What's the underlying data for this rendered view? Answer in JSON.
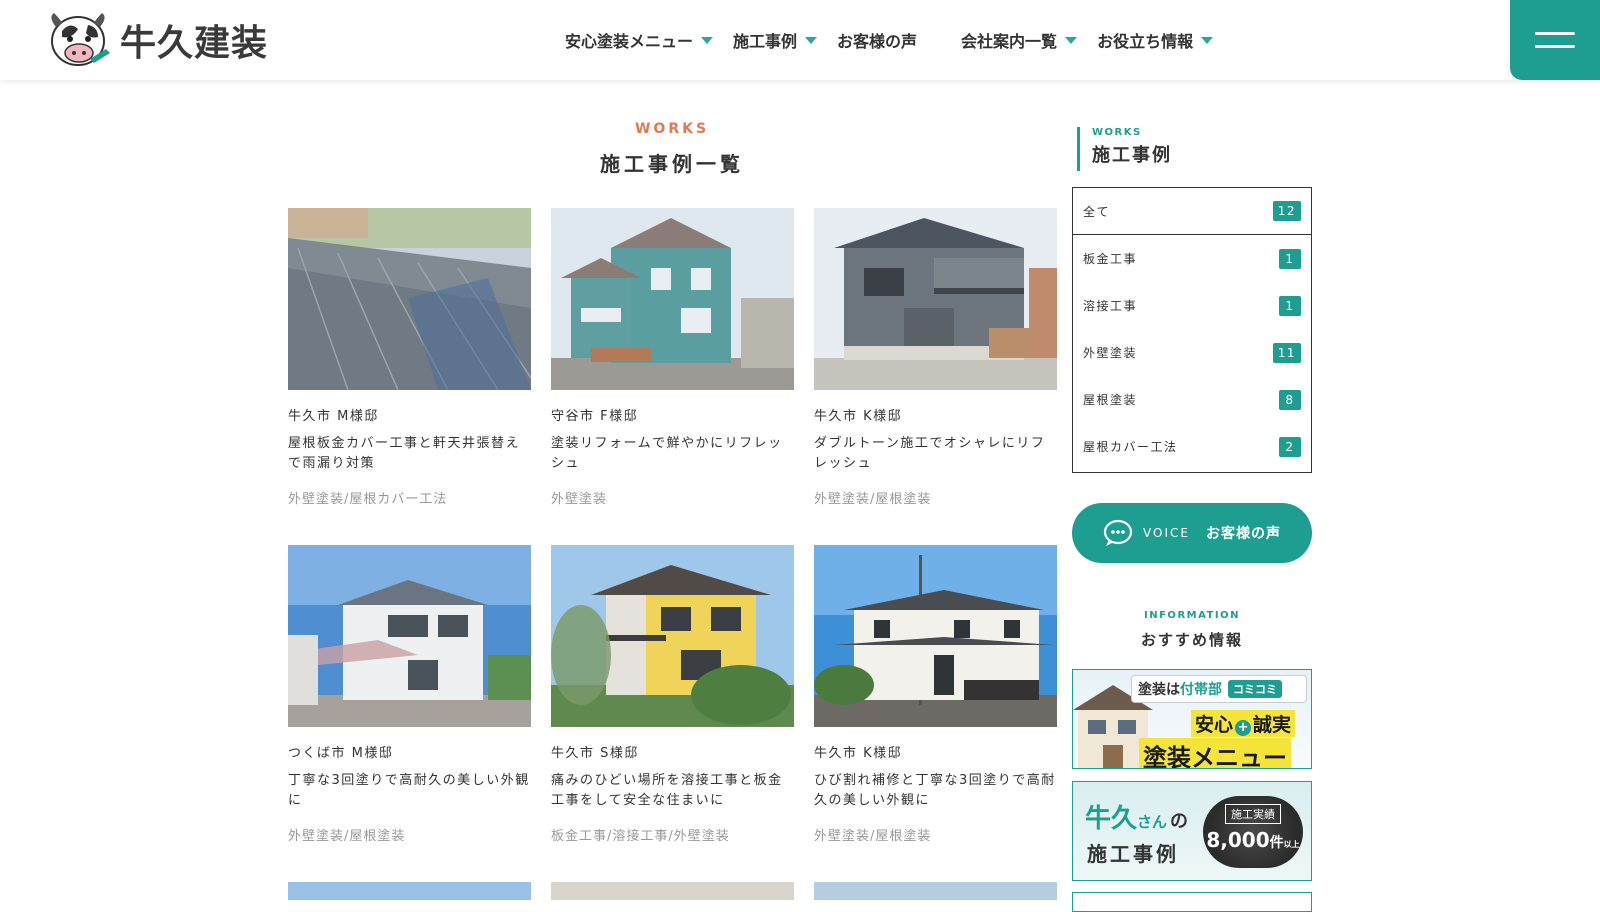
{
  "header": {
    "logo_text": "牛久建装",
    "nav": [
      {
        "label": "安心塗装メニュー",
        "has_dropdown": true
      },
      {
        "label": "施工事例",
        "has_dropdown": true
      },
      {
        "label": "お客様の声",
        "has_dropdown": false
      },
      {
        "label": "会社案内一覧",
        "has_dropdown": true
      },
      {
        "label": "お役立ち情報",
        "has_dropdown": true
      }
    ],
    "accent_color": "#1e9e90"
  },
  "main": {
    "section_en": "WORKS",
    "section_ja": "施工事例一覧",
    "works": [
      {
        "location": "牛久市 M様邸",
        "title": "屋根板金カバー工事と軒天井張替えで雨漏り対策",
        "tags": "外壁塗装/屋根カバー工法"
      },
      {
        "location": "守谷市 F様邸",
        "title": "塗装リフォームで鮮やかにリフレッシュ",
        "tags": "外壁塗装"
      },
      {
        "location": "牛久市 K様邸",
        "title": "ダブルトーン施工でオシャレにリフレッシュ",
        "tags": "外壁塗装/屋根塗装"
      },
      {
        "location": "つくば市 M様邸",
        "title": "丁寧な3回塗りで高耐久の美しい外観に",
        "tags": "外壁塗装/屋根塗装"
      },
      {
        "location": "牛久市 S様邸",
        "title": "痛みのひどい場所を溶接工事と板金工事をして安全な住まいに",
        "tags": "板金工事/溶接工事/外壁塗装"
      },
      {
        "location": "牛久市 K様邸",
        "title": "ひび割れ補修と丁寧な3回塗りで高耐久の美しい外観に",
        "tags": "外壁塗装/屋根塗装"
      }
    ]
  },
  "sidebar": {
    "head_en": "WORKS",
    "head_ja": "施工事例",
    "categories": [
      {
        "label": "全て",
        "count": "12"
      },
      {
        "label": "板金工事",
        "count": "1"
      },
      {
        "label": "溶接工事",
        "count": "1"
      },
      {
        "label": "外壁塗装",
        "count": "11"
      },
      {
        "label": "屋根塗装",
        "count": "8"
      },
      {
        "label": "屋根カバー工法",
        "count": "2"
      }
    ],
    "voice_en": "VOICE",
    "voice_ja": "お客様の声",
    "info_en": "INFORMATION",
    "info_ja": "おすすめ情報",
    "banner1": {
      "top_text_a": "塗装は",
      "top_text_b": "付帯部",
      "top_tag": "コミコミ",
      "mid_a": "安心",
      "mid_plus": "+",
      "mid_b": "誠実",
      "bottom": "塗装メニュー"
    },
    "banner2": {
      "brand": "牛久",
      "brand_small": "さん",
      "particle": "の",
      "line2": "施工事例",
      "badge_top": "施工実績",
      "badge_num": "8,000",
      "badge_unit": "件",
      "badge_over": "以上"
    }
  }
}
